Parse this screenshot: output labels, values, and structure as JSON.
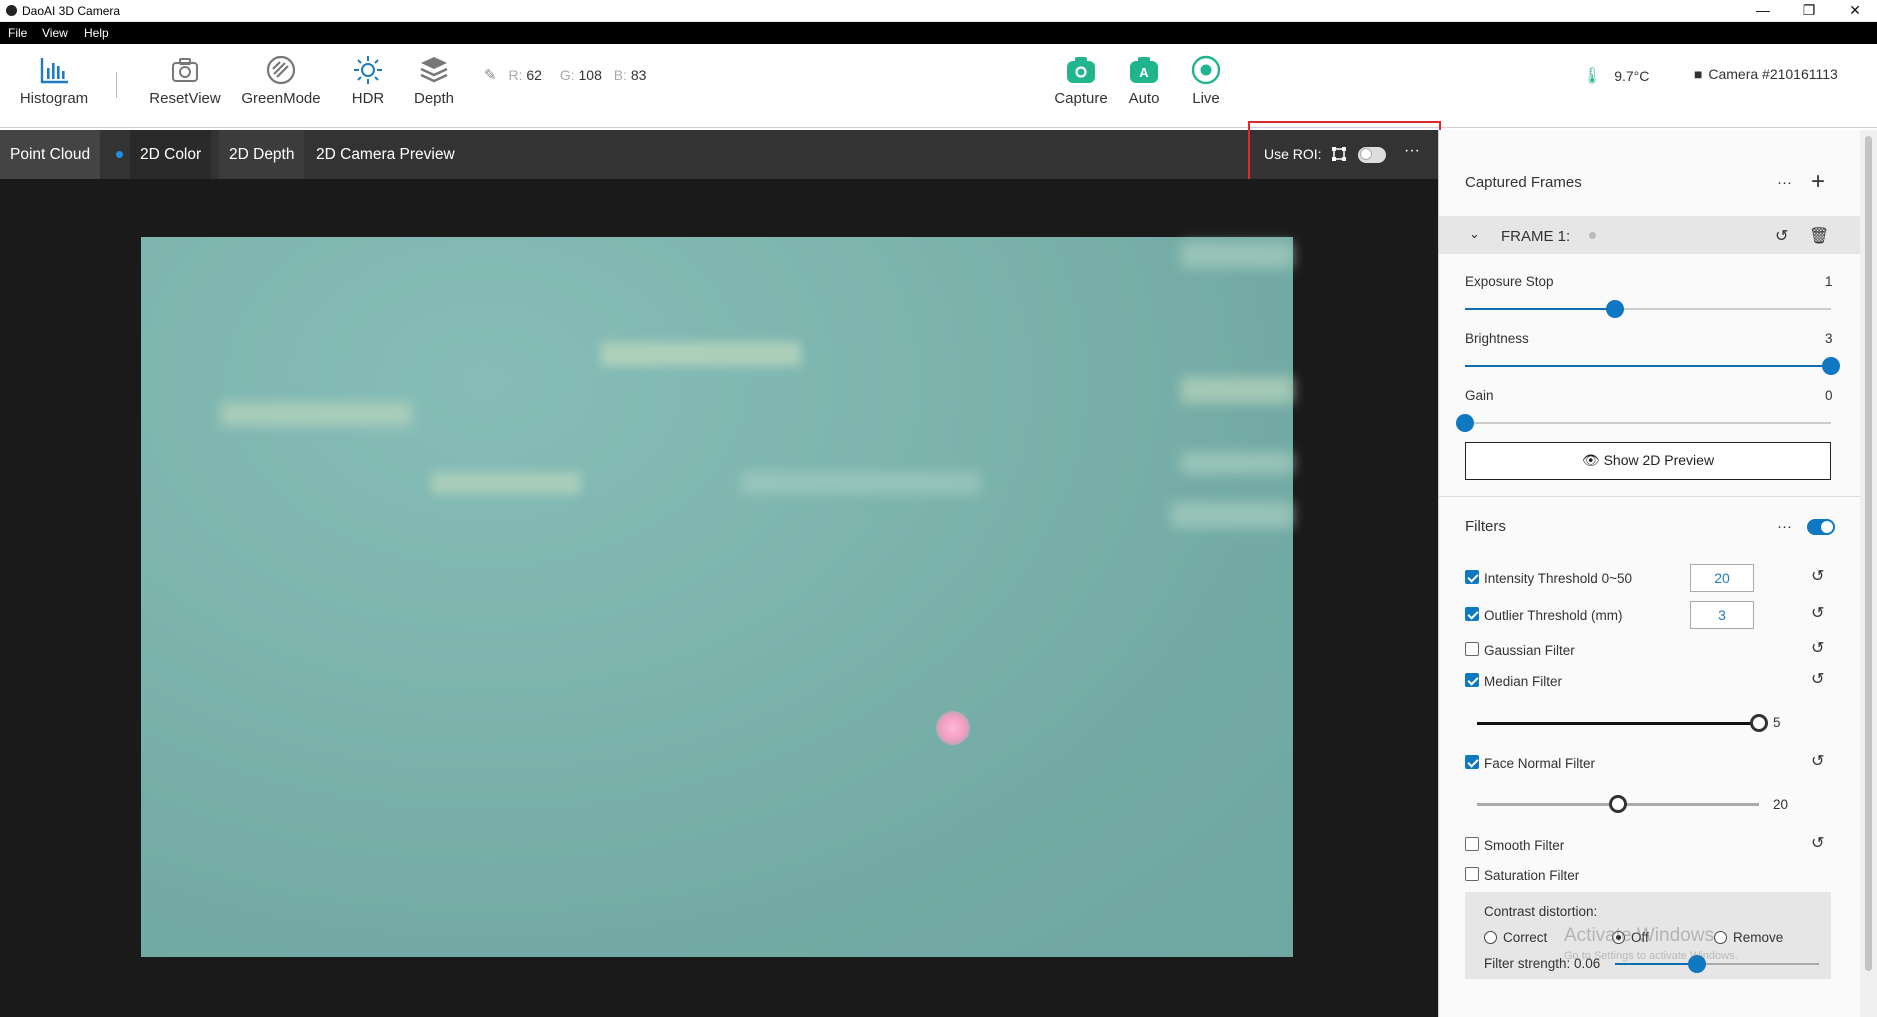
{
  "window": {
    "title": "DaoAI 3D Camera",
    "minimize": "—",
    "restore": "❐",
    "close": "✕"
  },
  "menu": [
    "File",
    "View",
    "Help"
  ],
  "toolbar": {
    "histogram": "Histogram",
    "reset_view": "ResetView",
    "green_mode": "GreenMode",
    "hdr": "HDR",
    "depth": "Depth",
    "rgb": {
      "r_label": "R:",
      "r": "62",
      "g_label": "G:",
      "g": "108",
      "b_label": "B:",
      "b": "83"
    },
    "capture": "Capture",
    "auto": "Auto",
    "auto_glyph": "A",
    "live": "Live",
    "temperature": "9.7°C",
    "camera": "Camera #210161113"
  },
  "tabs": {
    "point_cloud": "Point Cloud",
    "color_2d": "2D Color",
    "depth_2d": "2D Depth",
    "camera_preview": "2D Camera Preview",
    "use_roi": "Use ROI:",
    "more": "···"
  },
  "colors": {
    "accent": "#0e78c2",
    "green": "#20b58f",
    "roi_box": "#e0282e"
  },
  "panel": {
    "captured_frames": "Captured Frames",
    "more": "···",
    "add": "+",
    "frame_label": "FRAME 1:",
    "exposure_stop": {
      "label": "Exposure Stop",
      "value": "1",
      "fraction": 0.41
    },
    "brightness": {
      "label": "Brightness",
      "value": "3",
      "fraction": 1.0
    },
    "gain": {
      "label": "Gain",
      "value": "0",
      "fraction": 0.0
    },
    "show_preview": "Show 2D Preview",
    "filters_title": "Filters",
    "intensity": {
      "label": "Intensity Threshold  0~50",
      "value": "20"
    },
    "outlier": {
      "label": "Outlier Threshold (mm)",
      "value": "3"
    },
    "gaussian": "Gaussian Filter",
    "median": {
      "label": "Median Filter",
      "value": "5",
      "fraction": 1.0
    },
    "face_normal": {
      "label": "Face Normal Filter",
      "value": "20",
      "fraction": 0.5
    },
    "smooth": "Smooth Filter",
    "saturation": "Saturation Filter",
    "contrast_title": "Contrast distortion:",
    "correct": "Correct",
    "off": "Off",
    "remove": "Remove",
    "strength": "Filter strength: 0.06",
    "strength_fraction": 0.4,
    "watermark1": "Activate Windows",
    "watermark2": "Go to Settings to activate Windows."
  }
}
